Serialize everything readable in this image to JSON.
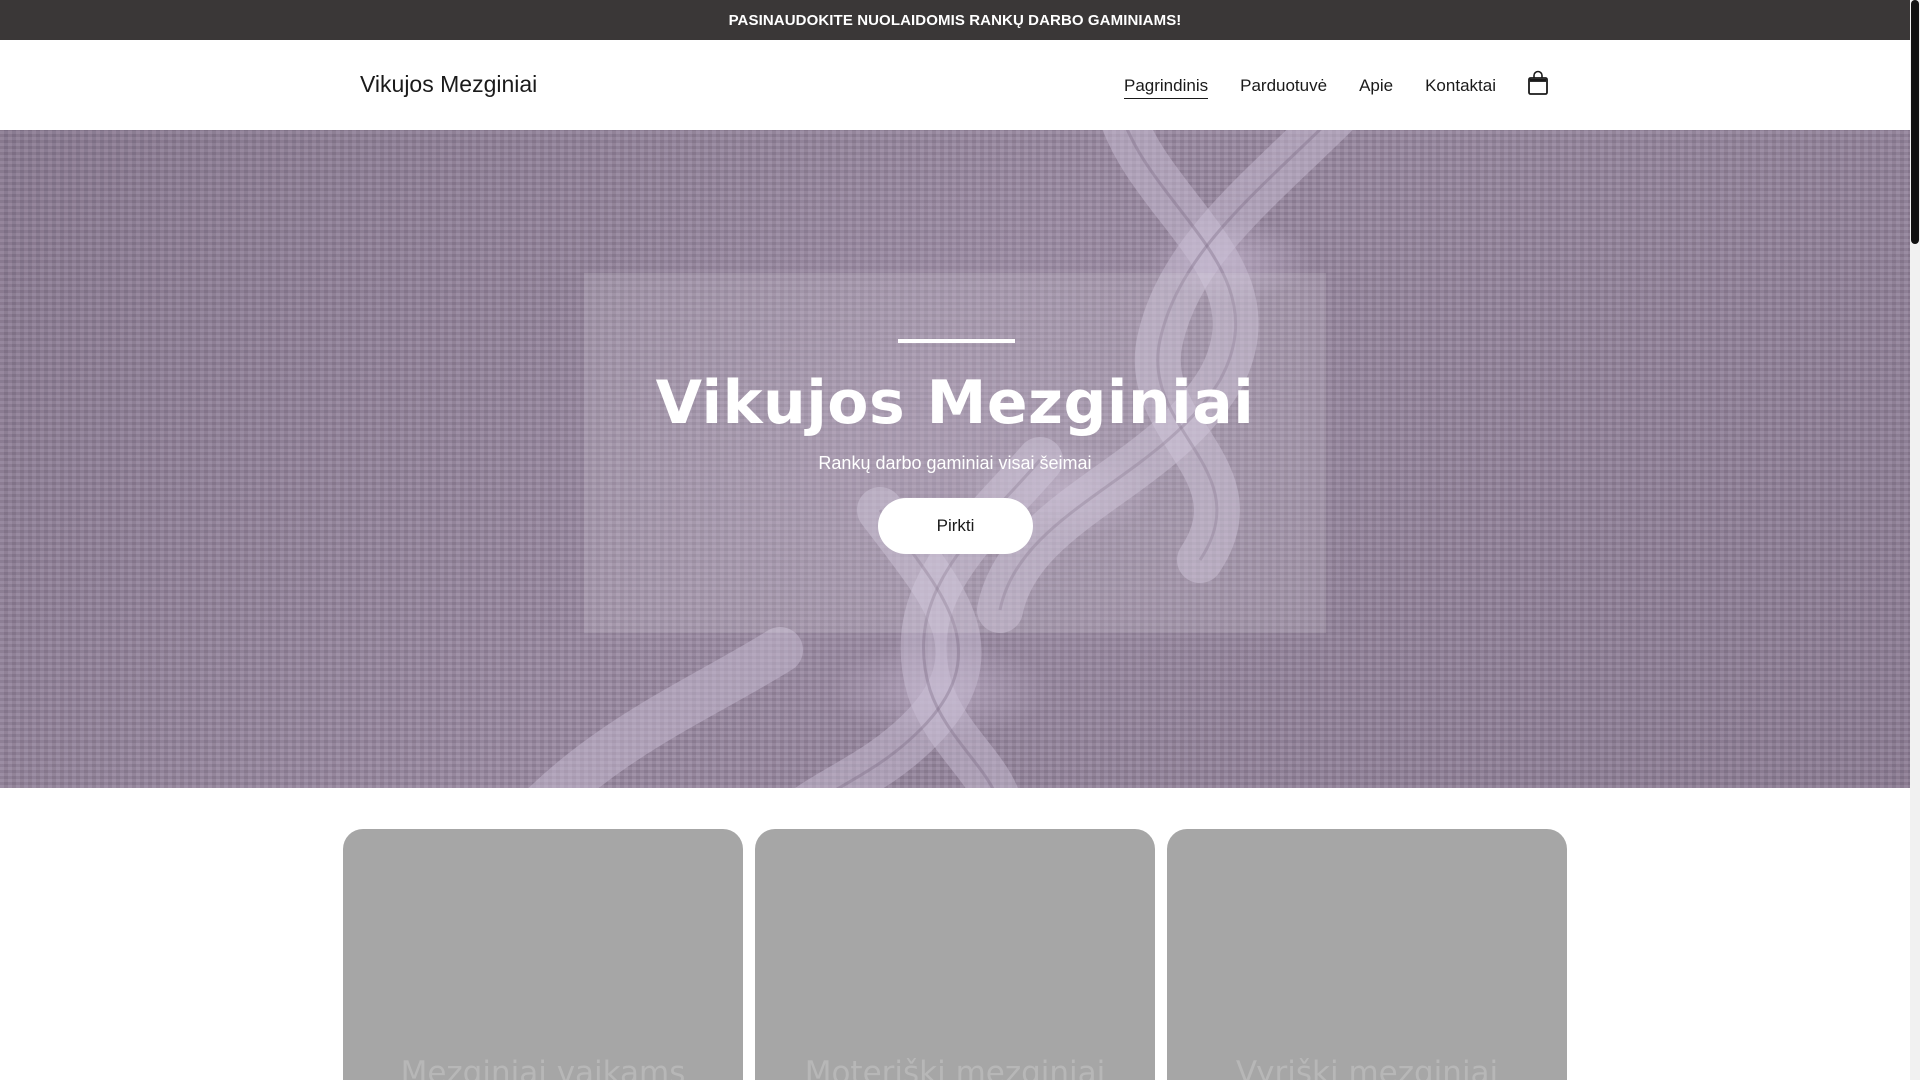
{
  "announcement": {
    "text": "PASINAUDOKITE NUOLAIDOMIS RANKŲ DARBO GAMINIAMS!"
  },
  "header": {
    "logo": "Vikujos Mezginiai",
    "nav": [
      {
        "label": "Pagrindinis",
        "active": true
      },
      {
        "label": "Parduotuvė",
        "active": false
      },
      {
        "label": "Apie",
        "active": false
      },
      {
        "label": "Kontaktai",
        "active": false
      }
    ],
    "cart_icon": "shopping-bag-icon"
  },
  "hero": {
    "title": "Vikujos Mezginiai",
    "subtitle": "Rankų darbo gaminiai visai šeimai",
    "button": "Pirkti",
    "background": "knitted cable pattern, lavender"
  },
  "categories": [
    {
      "title": "Mezginiai vaikams"
    },
    {
      "title": "Moteriški mezginiai"
    },
    {
      "title": "Vyriški mezginiai"
    }
  ],
  "colors": {
    "announcement_bg": "#3a3737",
    "hero_tint": "#8e7e95",
    "card_bg": "#a6a6a6"
  }
}
